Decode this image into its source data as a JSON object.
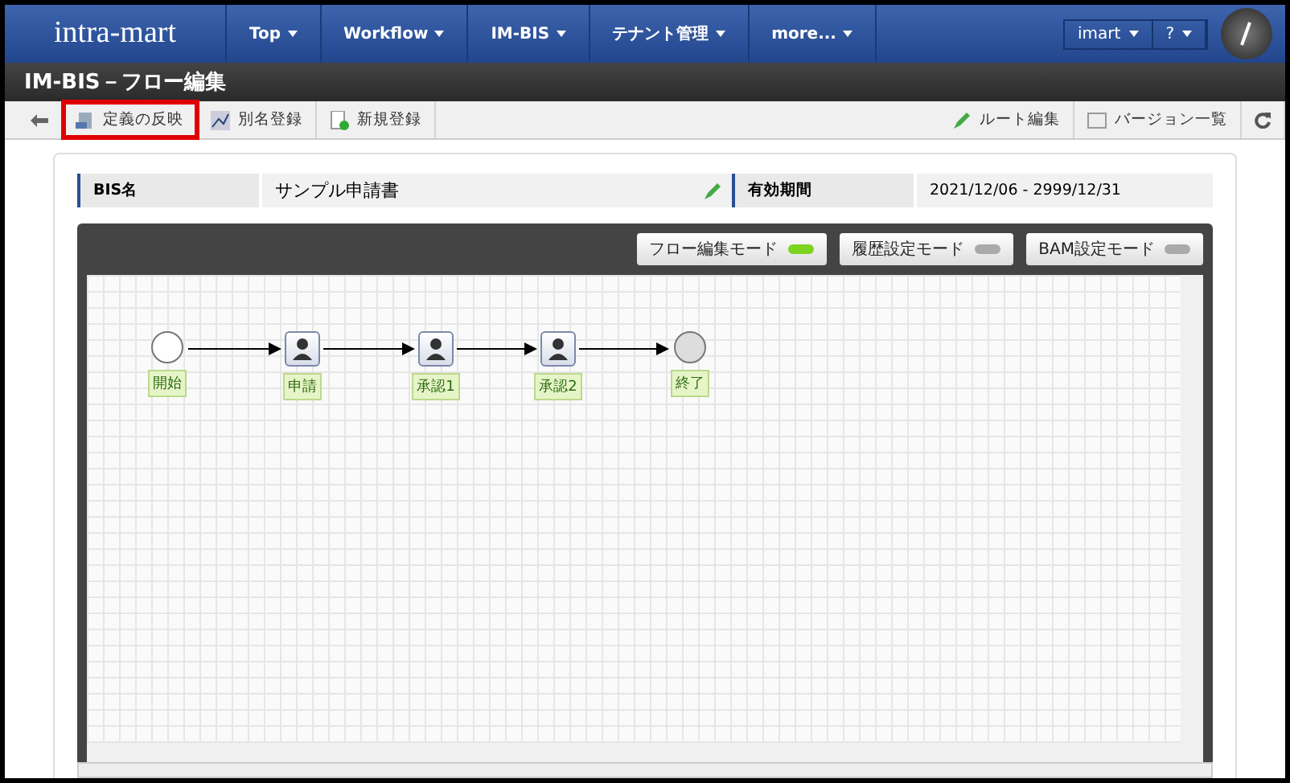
{
  "header": {
    "logo": "intra-mart",
    "menu": [
      {
        "label": "Top"
      },
      {
        "label": "Workflow"
      },
      {
        "label": "IM-BIS"
      },
      {
        "label": "テナント管理"
      },
      {
        "label": "more..."
      }
    ],
    "user": "imart",
    "help": "?"
  },
  "page_title": "IM-BIS－フロー編集",
  "toolbar": {
    "left": [
      {
        "label": "定義の反映",
        "highlighted": true
      },
      {
        "label": "別名登録",
        "highlighted": false
      },
      {
        "label": "新規登録",
        "highlighted": false
      }
    ],
    "right": [
      {
        "label": "ルート編集",
        "highlighted": false
      },
      {
        "label": "バージョン一覧",
        "highlighted": false
      }
    ]
  },
  "info": {
    "name_label": "BIS名",
    "name_value": "サンプル申請書",
    "period_label": "有効期間",
    "period_value": "2021/12/06  -  2999/12/31"
  },
  "modes": [
    {
      "label": "フロー編集モード",
      "on": true
    },
    {
      "label": "履歴設定モード",
      "on": false
    },
    {
      "label": "BAM設定モード",
      "on": false
    }
  ],
  "nodes": [
    {
      "kind": "start",
      "label": "開始"
    },
    {
      "kind": "task",
      "label": "申請"
    },
    {
      "kind": "task",
      "label": "承認1"
    },
    {
      "kind": "task",
      "label": "承認2"
    },
    {
      "kind": "end",
      "label": "終了"
    }
  ]
}
